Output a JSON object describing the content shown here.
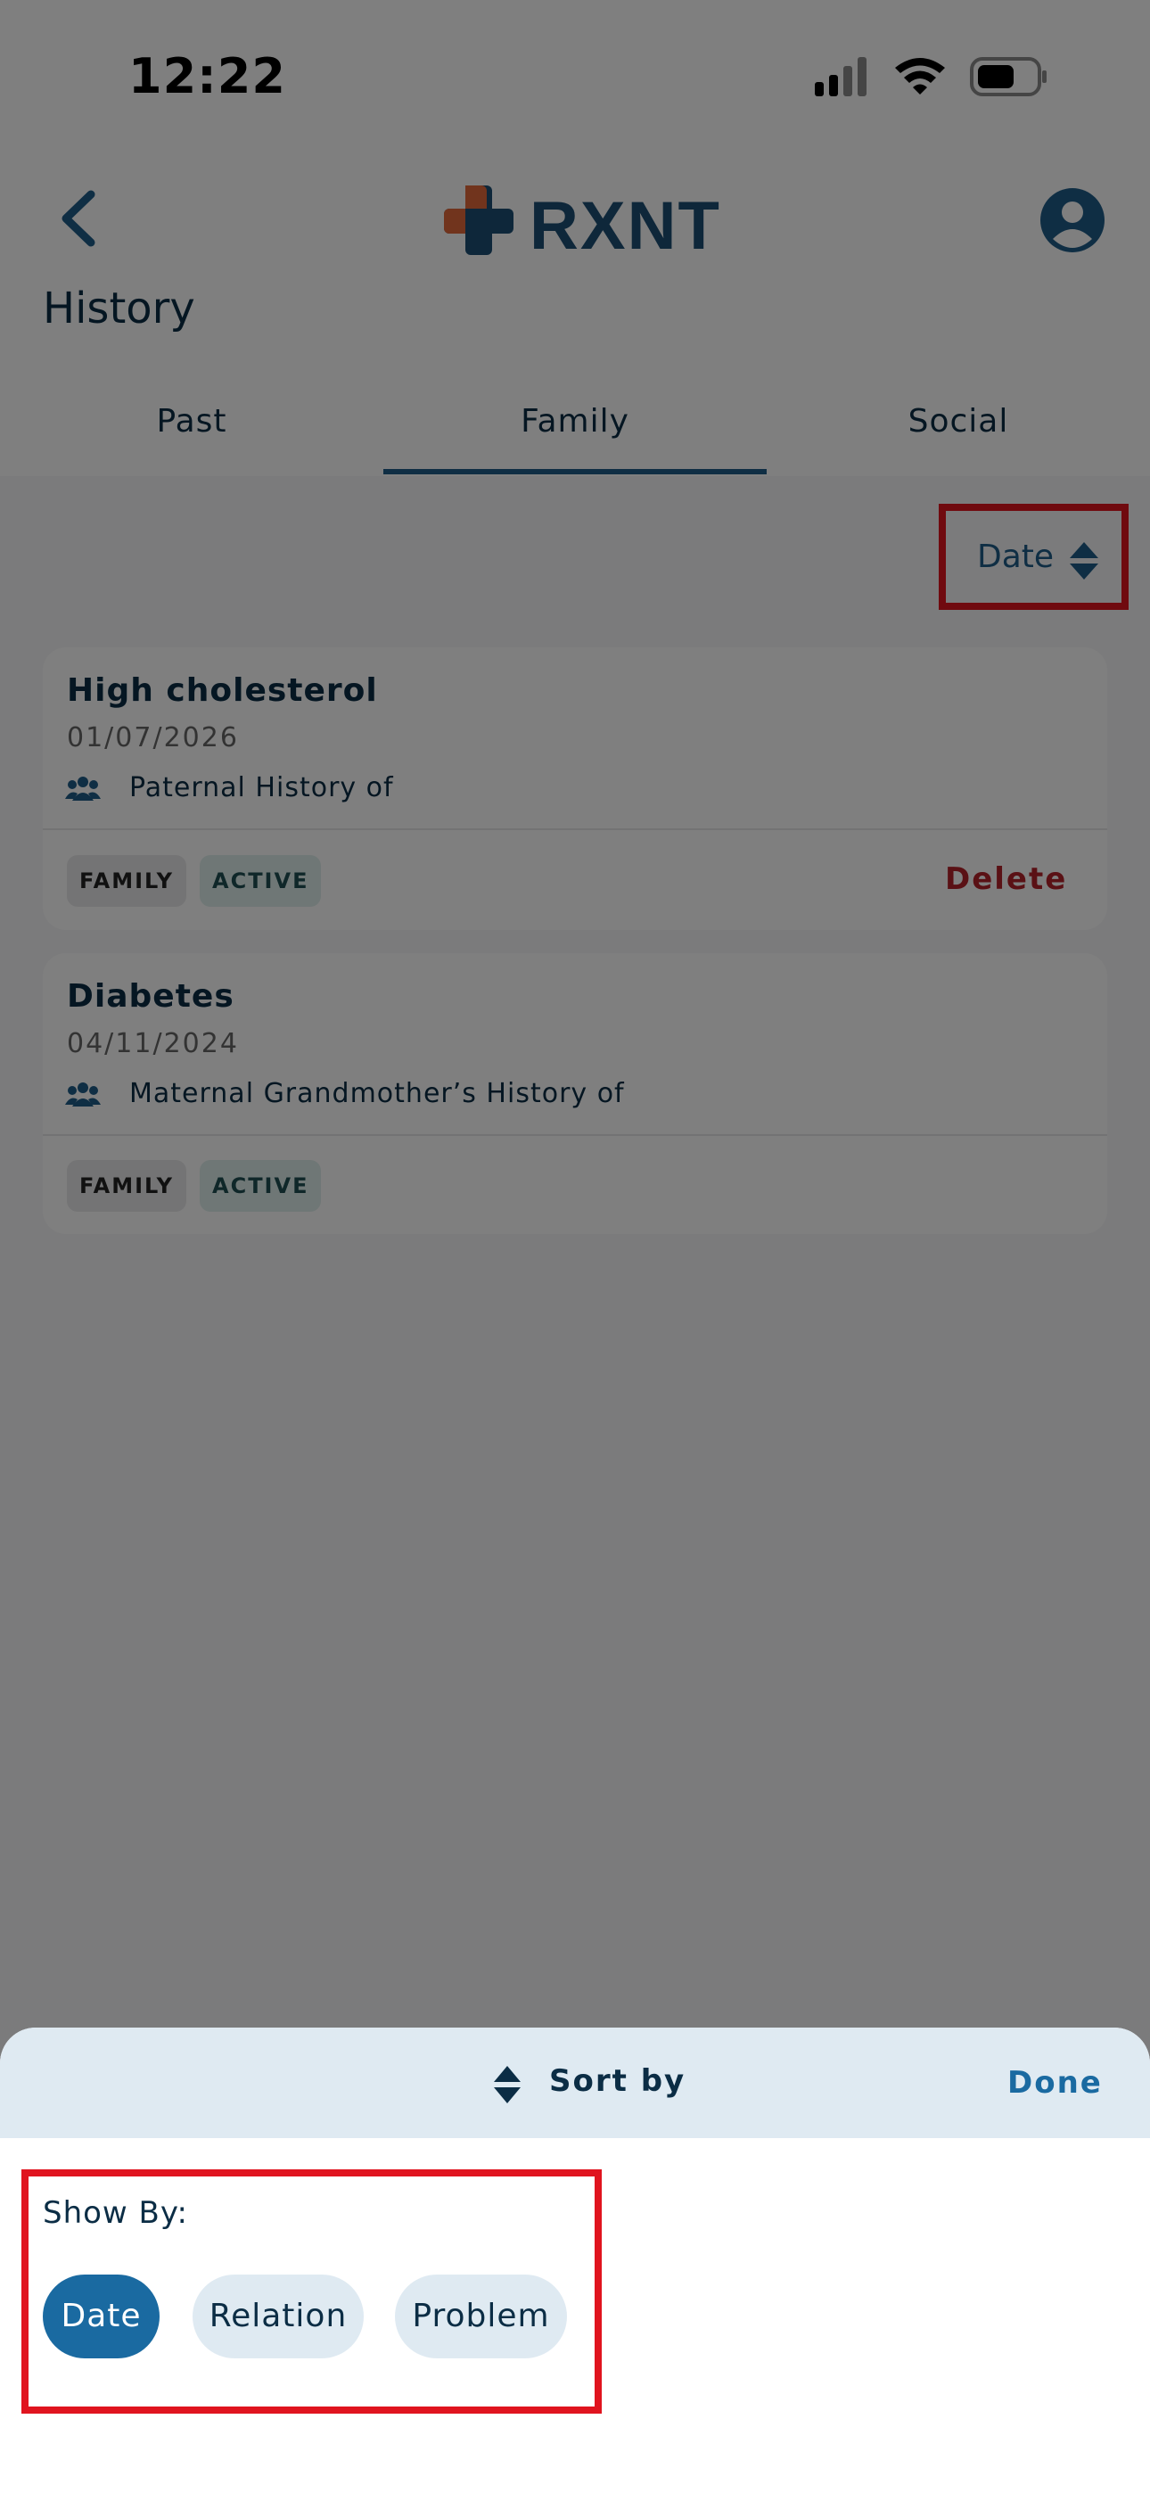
{
  "status_bar": {
    "time": "12:22"
  },
  "header": {
    "logo_text": "RXNT",
    "page_title": "History"
  },
  "tabs": [
    {
      "label": "Past",
      "active": false
    },
    {
      "label": "Family",
      "active": true
    },
    {
      "label": "Social",
      "active": false
    }
  ],
  "sort_button": {
    "label": "Date"
  },
  "records": [
    {
      "title": "High cholesterol",
      "date": "01/07/2026",
      "relation": "Paternal History of",
      "badges": [
        "FAMILY",
        "ACTIVE"
      ],
      "action": "Delete"
    },
    {
      "title": "Diabetes",
      "date": "04/11/2024",
      "relation": "Maternal Grandmother’s History of",
      "badges": [
        "FAMILY",
        "ACTIVE"
      ]
    }
  ],
  "sort_sheet": {
    "title": "Sort by",
    "done_label": "Done",
    "section_label": "Show By:",
    "options": [
      {
        "label": "Date",
        "selected": true
      },
      {
        "label": "Relation",
        "selected": false
      },
      {
        "label": "Problem",
        "selected": false
      }
    ]
  },
  "colors": {
    "brand_blue": "#1d4f74",
    "accent": "#1a6aa1",
    "logo_orange": "#e2683a",
    "delete_red": "#b4232a",
    "highlight_red": "#e0141f"
  }
}
